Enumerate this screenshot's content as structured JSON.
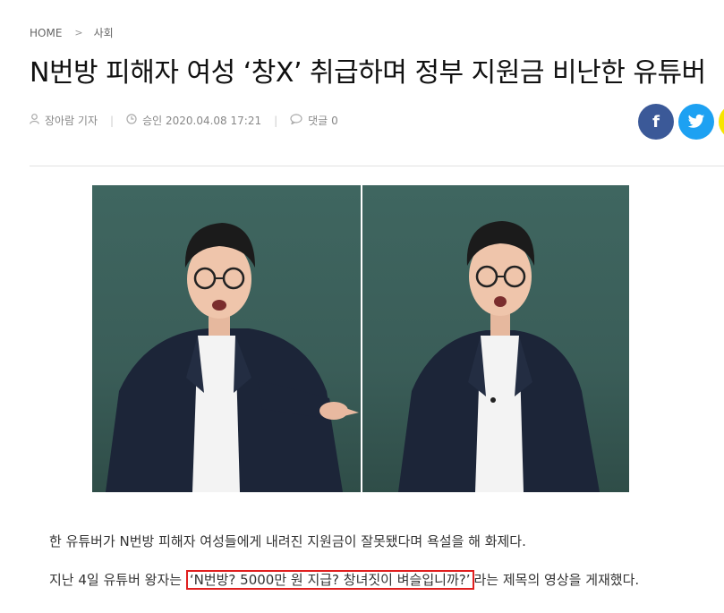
{
  "breadcrumb": {
    "home": "HOME",
    "separator": ">",
    "section": "사회"
  },
  "headline": "N번방 피해자 여성 ‘창X’ 취급하며 정부 지원금 비난한 유튜버",
  "meta": {
    "author": "장아람 기자",
    "date_label": "승인",
    "date": "2020.04.08 17:21",
    "comments_label": "댓글",
    "comments_count": "0"
  },
  "social": {
    "facebook": "f",
    "twitter": "t"
  },
  "colors": {
    "facebook": "#3b5998",
    "twitter": "#1da1f2",
    "kakao": "#f7e600",
    "highlight": "#e02020"
  },
  "article": {
    "p1": "한 유튜버가 N번방 피해자 여성들에게 내려진 지원금이 잘못됐다며 욕설을 해 화제다.",
    "p2_prefix": "지난 4일 유튜버 왕자는 ",
    "p2_quote": "‘N번방? 5000만 원 지급? 창녀짓이 벼슬입니까?’",
    "p2_suffix": "라는 제목의 영상을 게재했다."
  }
}
